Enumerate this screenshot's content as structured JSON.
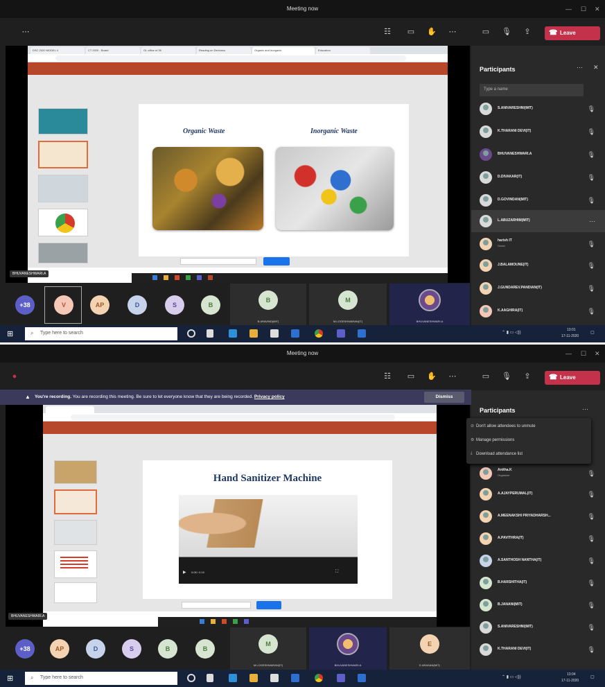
{
  "window_title": "Meeting now",
  "toolbar": {
    "leave_label": "Leave"
  },
  "participants_title": "Participants",
  "search_placeholder": "Type a name",
  "presenter_name": "BHUVANESHWARI.A",
  "screen1": {
    "browser_tabs": [
      "DSC 2020 MODEL 4",
      "CT 2020 - Board",
      "GL office of 36",
      "Reading on Deviceso",
      "Organic and Inorganic",
      "Education"
    ],
    "slide_left_title": "Organic Waste",
    "slide_right_title": "Inorganic Waste",
    "participants": [
      {
        "name": "S.ANIVARESHNI(MIT)"
      },
      {
        "name": "K.THARANI DEVI(IT)"
      },
      {
        "name": "BHUVANESHWARI.A"
      },
      {
        "name": "D.DIVAKAR(IT)"
      },
      {
        "name": "D.GOVINDAN(MIT)"
      },
      {
        "name": "L.ABUZARHIM(MIT)"
      },
      {
        "name": "harish IT",
        "role": "Guest"
      },
      {
        "name": "J.BALAMOUNE(IT)"
      },
      {
        "name": "J.GUNDAREV.PANDIAN(IT)"
      },
      {
        "name": "K.AAGHIRA(IT)"
      }
    ],
    "strip": [
      {
        "label": "+38",
        "color": "#5b5fc7",
        "fg": "#ffffff"
      },
      {
        "label": "V",
        "color": "#f4c7b6",
        "fg": "#b5542f"
      },
      {
        "label": "AP",
        "color": "#f3d3b2",
        "fg": "#9a5b26"
      },
      {
        "label": "D",
        "color": "#c7d3ea",
        "fg": "#3e5b93"
      },
      {
        "label": "S",
        "color": "#d9cdee",
        "fg": "#5c4796"
      },
      {
        "label": "B",
        "color": "#d6e5cf",
        "fg": "#4c7a3f"
      }
    ],
    "tiles": [
      {
        "initial": "B",
        "label": "B.ARAVIND(MIT)"
      },
      {
        "initial": "M",
        "label": "M.LOGESHWARAN(IT)"
      },
      {
        "initial": "",
        "label": "BHUVANESHWARI.A"
      }
    ],
    "clock_time": "13:01",
    "clock_date": "17-11-2020"
  },
  "screen2": {
    "banner_bold": "You're recording.",
    "banner_text": "You are recording this meeting. Be sure to let everyone know that they are being recorded.",
    "banner_link": "Privacy policy",
    "dismiss_label": "Dismiss",
    "slide_title": "Hand Sanitizer Machine",
    "video_time": "0:08 / 0:15",
    "menu_items": [
      "Don't allow attendees to unmute",
      "Manage permissions",
      "Download attendance list"
    ],
    "participants": [
      {
        "name": "Anitha.K",
        "role": "Organizer"
      },
      {
        "name": "A.AJAYPERUMAL(IT)"
      },
      {
        "name": "A.MEENAKSHI PRIYADHARSH..."
      },
      {
        "name": "A.PAVITHRA(IT)"
      },
      {
        "name": "A.SANTHOSH NANTHA(IT)"
      },
      {
        "name": "B.HARSHITHA(IT)"
      },
      {
        "name": "B.JANANI(MIT)"
      },
      {
        "name": "S.ANIVARESHNI(MIT)"
      },
      {
        "name": "K.THARANI DEVI(IT)"
      }
    ],
    "strip": [
      {
        "label": "+38",
        "color": "#5b5fc7",
        "fg": "#ffffff"
      },
      {
        "label": "AP",
        "color": "#f3d3b2",
        "fg": "#9a5b26"
      },
      {
        "label": "D",
        "color": "#c7d3ea",
        "fg": "#3e5b93"
      },
      {
        "label": "S",
        "color": "#d9cdee",
        "fg": "#5c4796"
      },
      {
        "label": "B",
        "color": "#d6e5cf",
        "fg": "#4c7a3f"
      },
      {
        "label": "B",
        "color": "#d6e5cf",
        "fg": "#4c7a3f"
      }
    ],
    "tiles": [
      {
        "initial": "M",
        "label": "M.LOGESHWARAN(IT)"
      },
      {
        "initial": "",
        "label": "BHUVANESHWARI.A"
      },
      {
        "initial": "E",
        "label": "E.ARASAN(MIT)"
      }
    ],
    "clock_time": "13:04",
    "clock_date": "17-11-2020"
  },
  "taskbar": {
    "search_placeholder": "Type here to search"
  },
  "colors": {
    "leave": "#c4314b",
    "ppt_ribbon": "#b7472a",
    "teams_purple": "#5b5fc7",
    "taskbar": "#16213a"
  }
}
